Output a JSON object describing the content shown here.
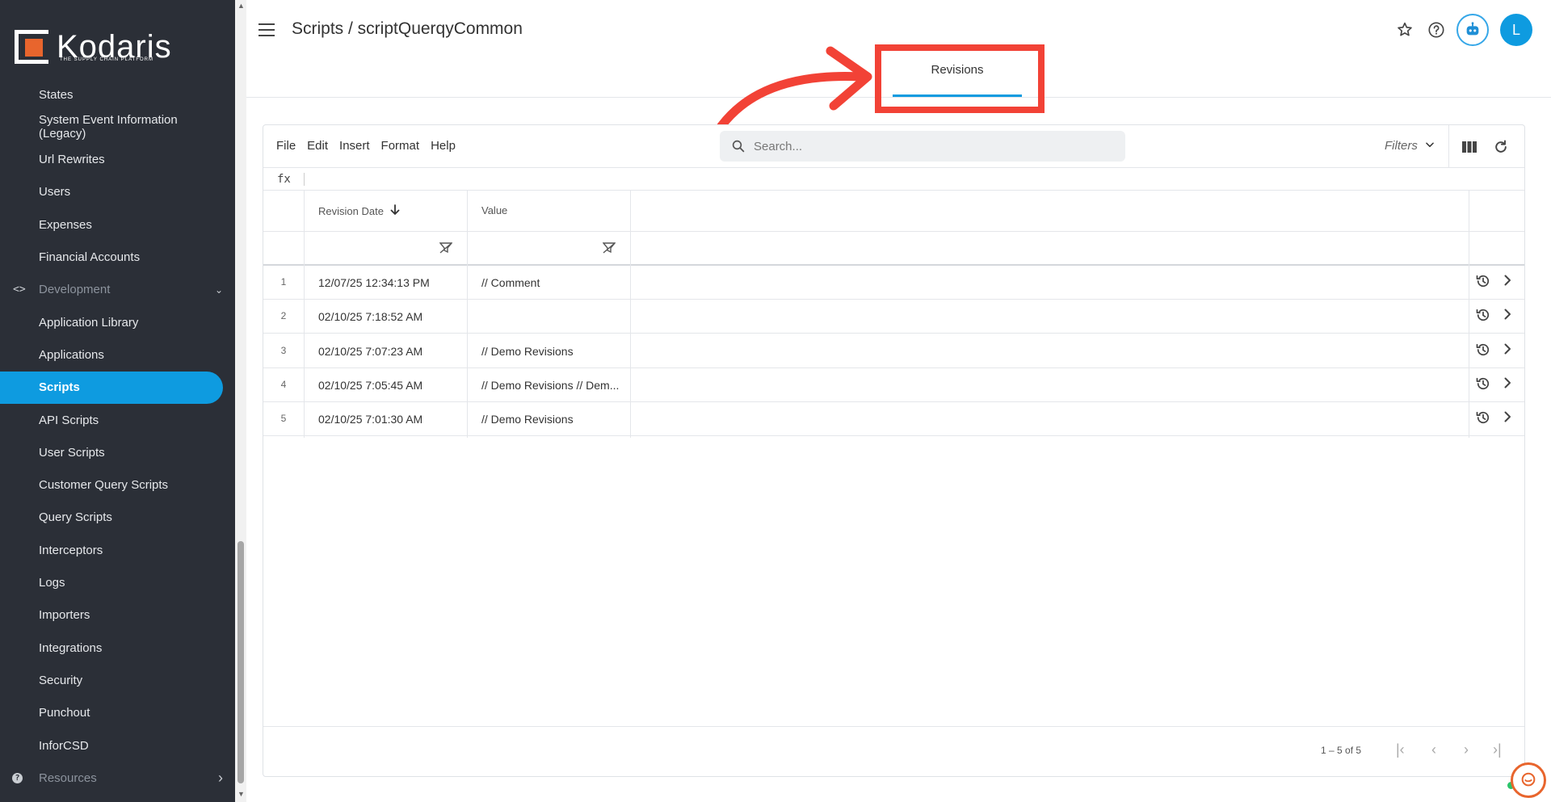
{
  "brand": {
    "name": "Kodaris",
    "tagline": "THE SUPPLY CHAIN PLATFORM",
    "accent": "#0e9be0",
    "logo_color": "#e8652d"
  },
  "sidebar": {
    "items": [
      {
        "label": "States"
      },
      {
        "label": "System Event Information (Legacy)"
      },
      {
        "label": "Url Rewrites"
      },
      {
        "label": "Users"
      },
      {
        "label": "Expenses"
      },
      {
        "label": "Financial Accounts"
      },
      {
        "label": "Development",
        "type": "section",
        "icon": "code-icon",
        "expanded": true
      },
      {
        "label": "Application Library"
      },
      {
        "label": "Applications"
      },
      {
        "label": "Scripts",
        "active": true
      },
      {
        "label": "API Scripts"
      },
      {
        "label": "User Scripts"
      },
      {
        "label": "Customer Query Scripts"
      },
      {
        "label": "Query Scripts"
      },
      {
        "label": "Interceptors"
      },
      {
        "label": "Logs"
      },
      {
        "label": "Importers"
      },
      {
        "label": "Integrations"
      },
      {
        "label": "Security"
      },
      {
        "label": "Punchout"
      },
      {
        "label": "InforCSD"
      },
      {
        "label": "Resources",
        "type": "section",
        "icon": "help-circle-icon",
        "expanded": false
      }
    ]
  },
  "header": {
    "breadcrumb": "Scripts / scriptQuerqyCommon",
    "avatar_initial": "L",
    "tabs": [
      {
        "label": "Revisions",
        "active": true
      }
    ]
  },
  "annotation": {
    "highlight_color": "#f24236",
    "target": "Revisions tab"
  },
  "toolbar": {
    "menu": [
      "File",
      "Edit",
      "Insert",
      "Format",
      "Help"
    ],
    "search_placeholder": "Search...",
    "filters_label": "Filters"
  },
  "formula_bar": {
    "label": "fx"
  },
  "table": {
    "columns": [
      {
        "label": "Revision Date",
        "sort": "desc"
      },
      {
        "label": "Value"
      }
    ],
    "rows": [
      {
        "num": "1",
        "date": "12/07/25 12:34:13 PM",
        "value": "// Comment"
      },
      {
        "num": "2",
        "date": "02/10/25 7:18:52 AM",
        "value": ""
      },
      {
        "num": "3",
        "date": "02/10/25 7:07:23 AM",
        "value": "// Demo Revisions"
      },
      {
        "num": "4",
        "date": "02/10/25 7:05:45 AM",
        "value": "// Demo Revisions // Dem..."
      },
      {
        "num": "5",
        "date": "02/10/25 7:01:30 AM",
        "value": "// Demo Revisions"
      }
    ]
  },
  "pager": {
    "text": "1 – 5 of 5"
  }
}
